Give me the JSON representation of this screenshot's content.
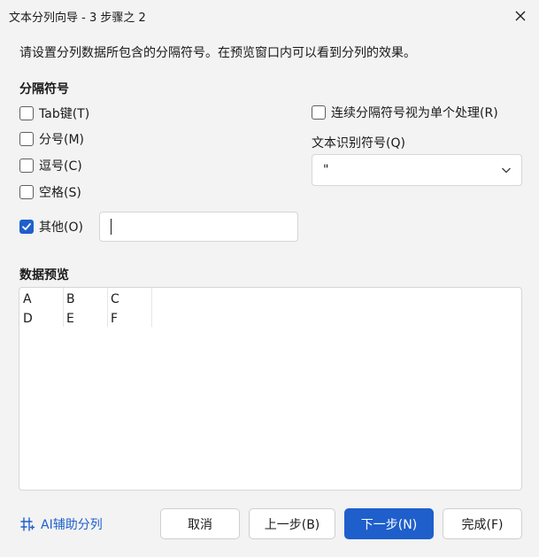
{
  "window": {
    "title": "文本分列向导 - 3 步骤之 2"
  },
  "instruction": "请设置分列数据所包含的分隔符号。在预览窗口内可以看到分列的效果。",
  "delimiters": {
    "section_title": "分隔符号",
    "options": [
      {
        "label": "Tab键(T)",
        "checked": false
      },
      {
        "label": "分号(M)",
        "checked": false
      },
      {
        "label": "逗号(C)",
        "checked": false
      },
      {
        "label": "空格(S)",
        "checked": false
      },
      {
        "label": "其他(O)",
        "checked": true
      }
    ],
    "other_value": ""
  },
  "consecutive": {
    "label": "连续分隔符号视为单个处理(R)",
    "checked": false
  },
  "text_qualifier": {
    "label": "文本识别符号(Q)",
    "value": "\""
  },
  "preview": {
    "section_title": "数据预览",
    "rows": [
      [
        "A",
        "B",
        "C"
      ],
      [
        "D",
        "E",
        "F"
      ]
    ]
  },
  "footer": {
    "ai_label": "AI辅助分列",
    "cancel_label": "取消",
    "back_label": "上一步(B)",
    "next_label": "下一步(N)",
    "finish_label": "完成(F)"
  },
  "colors": {
    "accent": "#1f5fcc",
    "border": "#d6d6d6",
    "background": "#f3f3f3"
  },
  "icons": {
    "close": "close-icon",
    "dropdown": "chevron-down-icon",
    "check": "check-icon",
    "ai": "ai-split-icon"
  }
}
